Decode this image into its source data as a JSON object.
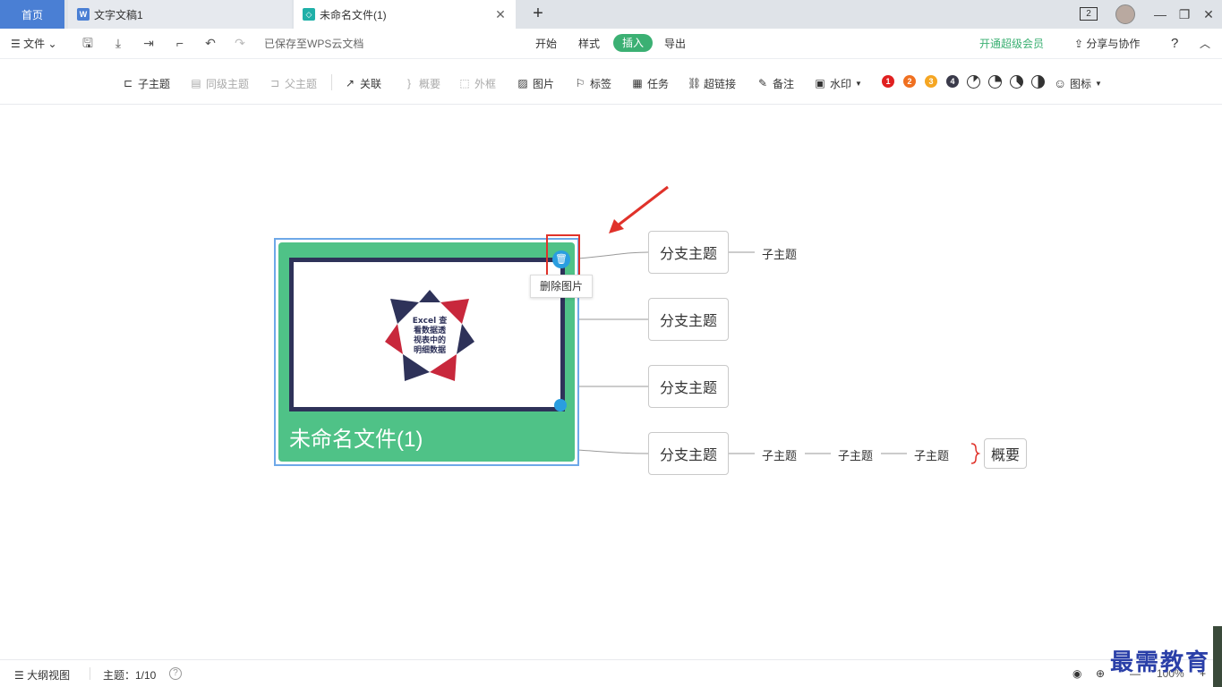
{
  "tabs": {
    "home": "首页",
    "doc": "文字文稿1",
    "active": "未命名文件(1)",
    "window_count": "2"
  },
  "menubar": {
    "file": "文件",
    "saved_status": "已保存至WPS云文档",
    "tabs": [
      "开始",
      "样式",
      "插入",
      "导出"
    ],
    "active_tab": "插入",
    "vip": "开通超级会员",
    "share": "分享与协作",
    "help": "?"
  },
  "toolbar": {
    "child_topic": "子主题",
    "sibling_topic": "同级主题",
    "parent_topic": "父主题",
    "relation": "关联",
    "summary": "概要",
    "frame": "外框",
    "image": "图片",
    "tag": "标签",
    "task": "任务",
    "hyperlink": "超链接",
    "note": "备注",
    "watermark": "水印",
    "icons": "图标",
    "priority": [
      "1",
      "2",
      "3",
      "4"
    ],
    "colors": {
      "p1": "#e02020",
      "p2": "#f07020",
      "p3": "#f5a623",
      "p4": "#3a3a4a"
    }
  },
  "mindmap": {
    "central_title": "未命名文件(1)",
    "image_text": [
      "Excel 查",
      "看数据透",
      "视表中的",
      "明细数据"
    ],
    "delete_tooltip": "删除图片",
    "branches": [
      "分支主题",
      "分支主题",
      "分支主题",
      "分支主题"
    ],
    "branch1_sub": "子主题",
    "branch4_subs": [
      "子主题",
      "子主题",
      "子主题"
    ],
    "summary": "概要"
  },
  "statusbar": {
    "outline": "大纲视图",
    "topic_count": "主题：1/10",
    "zoom": "100%"
  },
  "watermark_text": "最需教育"
}
